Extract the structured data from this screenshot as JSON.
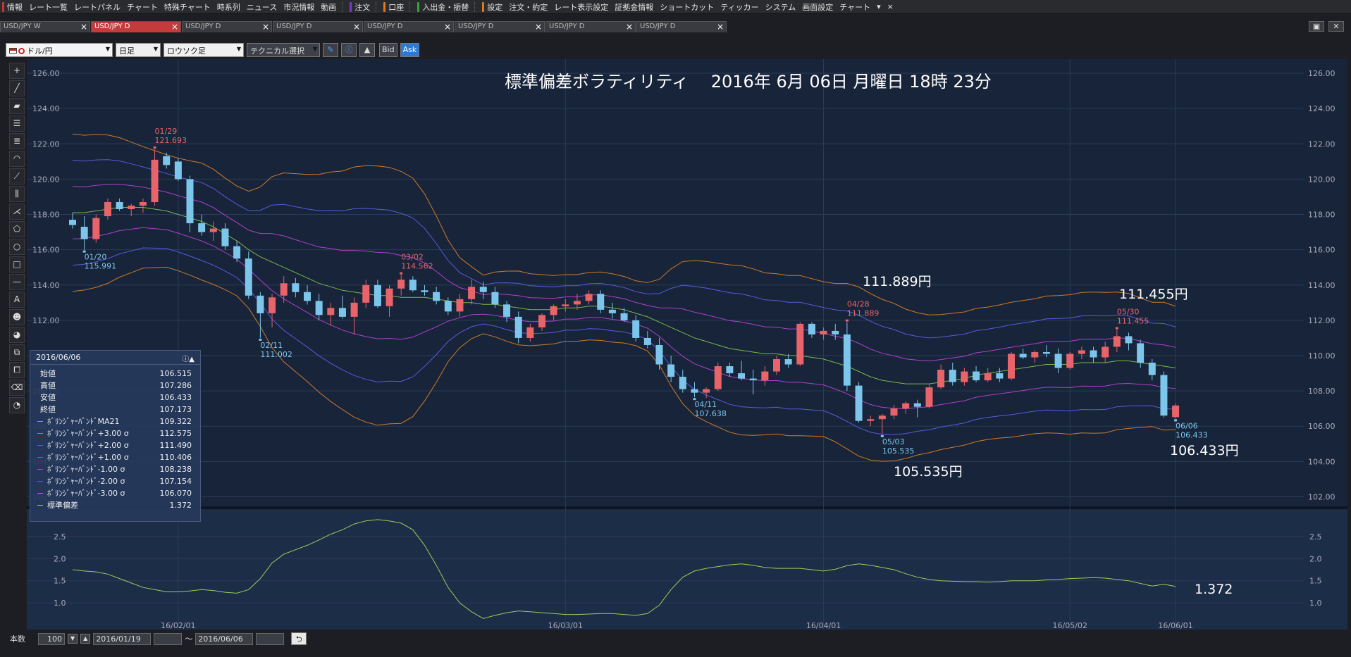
{
  "menu": {
    "items": [
      {
        "label": "情報",
        "color": "#d0342c"
      },
      {
        "label": "レート一覧",
        "color": ""
      },
      {
        "label": "レートパネル",
        "color": ""
      },
      {
        "label": "チャート",
        "color": ""
      },
      {
        "label": "特殊チャート",
        "color": ""
      },
      {
        "label": "時系列",
        "color": ""
      },
      {
        "label": "ニュース",
        "color": ""
      },
      {
        "label": "市況情報",
        "color": ""
      },
      {
        "label": "動画",
        "color": ""
      },
      {
        "label": "注文",
        "color": "#7a3cc8"
      },
      {
        "label": "口座",
        "color": "#e07820"
      },
      {
        "label": "入出金・振替",
        "color": "#3aa03a"
      },
      {
        "label": "設定",
        "color": "#e07820"
      },
      {
        "label": "注文・約定",
        "color": ""
      },
      {
        "label": "レート表示設定",
        "color": ""
      },
      {
        "label": "証拠金情報",
        "color": ""
      },
      {
        "label": "ショートカット",
        "color": ""
      },
      {
        "label": "ティッカー",
        "color": ""
      },
      {
        "label": "システム",
        "color": ""
      },
      {
        "label": "画面設定",
        "color": ""
      },
      {
        "label": "チャート",
        "color": ""
      }
    ],
    "more": "▾",
    "close": "×"
  },
  "tabs": [
    {
      "label": "USD/JPY W",
      "active": false
    },
    {
      "label": "USD/JPY D",
      "active": true
    },
    {
      "label": "USD/JPY D",
      "active": false
    },
    {
      "label": "USD/JPY D",
      "active": false
    },
    {
      "label": "USD/JPY D",
      "active": false
    },
    {
      "label": "USD/JPY D",
      "active": false
    },
    {
      "label": "USD/JPY D",
      "active": false
    },
    {
      "label": "USD/JPY D",
      "active": false
    }
  ],
  "toolbar": {
    "pair": "ドル/円",
    "period": "日足",
    "chart_type": "ロウソク足",
    "technical": "テクニカル選択",
    "bid": "Bid",
    "ask": "Ask"
  },
  "chart_title": "標準偏差ボラティリティ　 2016年 6月 06日 月曜日 18時 23分",
  "annotations": {
    "a1": "111.889円",
    "a2": "111.455円",
    "a3": "105.535円",
    "a4": "106.433円",
    "a5": "1.372"
  },
  "point_labels": [
    {
      "date": "01/29",
      "val": "121.693",
      "kind": "high"
    },
    {
      "date": "01/20",
      "val": "115.991",
      "kind": "low"
    },
    {
      "date": "03/02",
      "val": "114.562",
      "kind": "high"
    },
    {
      "date": "02/11",
      "val": "111.002",
      "kind": "low"
    },
    {
      "date": "04/28",
      "val": "111.889",
      "kind": "high"
    },
    {
      "date": "04/11",
      "val": "107.638",
      "kind": "low"
    },
    {
      "date": "05/03",
      "val": "105.535",
      "kind": "low"
    },
    {
      "date": "05/30",
      "val": "111.455",
      "kind": "high"
    },
    {
      "date": "06/06",
      "val": "106.433",
      "kind": "low"
    }
  ],
  "info": {
    "date": "2016/06/06",
    "rows": [
      {
        "label": "始値",
        "value": "106.515",
        "color": ""
      },
      {
        "label": "高値",
        "value": "107.286",
        "color": ""
      },
      {
        "label": "安値",
        "value": "106.433",
        "color": ""
      },
      {
        "label": "終値",
        "value": "107.173",
        "color": ""
      },
      {
        "label": "ﾎﾞﾘﾝｼﾞｬｰﾊﾞﾝﾄﾞMA21",
        "value": "109.322",
        "color": "#7ab84a"
      },
      {
        "label": "ﾎﾞﾘﾝｼﾞｬｰﾊﾞﾝﾄﾞ+3.00 σ",
        "value": "112.575",
        "color": "#d07a2a"
      },
      {
        "label": "ﾎﾞﾘﾝｼﾞｬｰﾊﾞﾝﾄﾞ+2.00 σ",
        "value": "111.490",
        "color": "#5a5ae0"
      },
      {
        "label": "ﾎﾞﾘﾝｼﾞｬｰﾊﾞﾝﾄﾞ+1.00 σ",
        "value": "110.406",
        "color": "#b040d0"
      },
      {
        "label": "ﾎﾞﾘﾝｼﾞｬｰﾊﾞﾝﾄﾞ-1.00 σ",
        "value": "108.238",
        "color": "#b040d0"
      },
      {
        "label": "ﾎﾞﾘﾝｼﾞｬｰﾊﾞﾝﾄﾞ-2.00 σ",
        "value": "107.154",
        "color": "#5a5ae0"
      },
      {
        "label": "ﾎﾞﾘﾝｼﾞｬｰﾊﾞﾝﾄﾞ-3.00 σ",
        "value": "106.070",
        "color": "#d07a2a"
      },
      {
        "label": "標準偏差",
        "value": "1.372",
        "color": "#9ccc5a"
      }
    ]
  },
  "bottom": {
    "count_label": "本数",
    "count": "100",
    "from": "2016/01/19",
    "tilde": "～",
    "to": "2016/06/06"
  },
  "chart_data": [
    {
      "type": "candlestick",
      "ylim": [
        101.5,
        126.8
      ],
      "y_ticks": [
        "126.00",
        "124.00",
        "122.00",
        "120.00",
        "118.00",
        "116.00",
        "114.00",
        "112.00",
        "110.00",
        "108.00",
        "106.00",
        "104.00",
        "102.00"
      ],
      "x_ticks": [
        "16/02/01",
        "16/03/01",
        "16/04/01",
        "16/05/02",
        "16/06/01"
      ],
      "ohlc": [
        [
          117.7,
          118.1,
          117.2,
          117.4
        ],
        [
          117.3,
          117.9,
          116.0,
          116.6
        ],
        [
          116.6,
          118.0,
          116.4,
          117.8
        ],
        [
          117.9,
          118.9,
          117.7,
          118.7
        ],
        [
          118.7,
          118.9,
          118.2,
          118.3
        ],
        [
          118.3,
          118.6,
          117.9,
          118.5
        ],
        [
          118.5,
          118.9,
          118.1,
          118.7
        ],
        [
          118.7,
          121.69,
          118.5,
          121.1
        ],
        [
          121.3,
          121.5,
          120.6,
          120.8
        ],
        [
          121.0,
          121.2,
          119.9,
          120.0
        ],
        [
          120.0,
          120.2,
          117.0,
          117.5
        ],
        [
          117.5,
          118.0,
          116.8,
          117.0
        ],
        [
          117.0,
          117.6,
          116.5,
          117.2
        ],
        [
          117.2,
          117.5,
          116.0,
          116.2
        ],
        [
          116.2,
          116.5,
          115.3,
          115.5
        ],
        [
          115.5,
          115.9,
          113.2,
          113.4
        ],
        [
          113.4,
          113.6,
          111.0,
          112.4
        ],
        [
          112.4,
          113.5,
          111.6,
          113.3
        ],
        [
          113.4,
          114.5,
          113.0,
          114.1
        ],
        [
          114.1,
          114.4,
          113.3,
          113.6
        ],
        [
          113.6,
          114.0,
          112.9,
          113.1
        ],
        [
          113.1,
          113.5,
          112.0,
          112.3
        ],
        [
          112.3,
          113.0,
          111.7,
          112.7
        ],
        [
          112.7,
          113.4,
          112.1,
          112.2
        ],
        [
          112.2,
          113.3,
          111.2,
          113.0
        ],
        [
          113.0,
          114.3,
          112.7,
          114.0
        ],
        [
          114.0,
          114.3,
          112.7,
          112.8
        ],
        [
          112.8,
          114.0,
          112.2,
          113.8
        ],
        [
          113.8,
          114.56,
          113.4,
          114.3
        ],
        [
          114.3,
          114.5,
          113.6,
          113.7
        ],
        [
          113.7,
          114.0,
          113.4,
          113.6
        ],
        [
          113.6,
          113.9,
          112.9,
          113.1
        ],
        [
          113.1,
          113.3,
          112.3,
          112.5
        ],
        [
          112.5,
          113.5,
          112.2,
          113.2
        ],
        [
          113.2,
          114.3,
          112.9,
          113.9
        ],
        [
          113.9,
          114.2,
          113.2,
          113.6
        ],
        [
          113.6,
          113.9,
          112.7,
          112.9
        ],
        [
          112.9,
          113.1,
          111.9,
          112.2
        ],
        [
          112.2,
          112.5,
          110.7,
          111.0
        ],
        [
          111.0,
          111.8,
          110.8,
          111.6
        ],
        [
          111.6,
          112.4,
          111.4,
          112.3
        ],
        [
          112.3,
          112.9,
          112.0,
          112.8
        ],
        [
          112.8,
          113.2,
          112.5,
          112.9
        ],
        [
          112.9,
          113.5,
          112.6,
          113.1
        ],
        [
          113.1,
          113.7,
          112.9,
          113.5
        ],
        [
          113.5,
          113.7,
          112.4,
          112.6
        ],
        [
          112.6,
          113.0,
          112.1,
          112.4
        ],
        [
          112.4,
          112.7,
          111.9,
          112.0
        ],
        [
          112.0,
          112.3,
          110.8,
          111.0
        ],
        [
          111.0,
          111.4,
          110.4,
          110.6
        ],
        [
          110.6,
          111.0,
          109.2,
          109.5
        ],
        [
          109.5,
          110.0,
          108.5,
          108.8
        ],
        [
          108.8,
          109.2,
          107.9,
          108.1
        ],
        [
          108.1,
          108.5,
          107.638,
          107.9
        ],
        [
          107.9,
          108.2,
          107.6,
          108.1
        ],
        [
          108.1,
          109.6,
          108.0,
          109.4
        ],
        [
          109.4,
          109.6,
          108.8,
          109.0
        ],
        [
          109.0,
          109.7,
          108.6,
          108.7
        ],
        [
          108.7,
          109.2,
          107.8,
          108.6
        ],
        [
          108.6,
          109.4,
          108.3,
          109.1
        ],
        [
          109.1,
          110.0,
          108.9,
          109.8
        ],
        [
          109.8,
          110.1,
          109.3,
          109.5
        ],
        [
          109.5,
          111.9,
          109.4,
          111.8
        ],
        [
          111.8,
          111.9,
          111.0,
          111.2
        ],
        [
          111.2,
          111.6,
          110.9,
          111.4
        ],
        [
          111.4,
          111.8,
          110.9,
          111.2
        ],
        [
          111.2,
          111.889,
          108.0,
          108.3
        ],
        [
          108.3,
          108.5,
          106.2,
          106.3
        ],
        [
          106.3,
          106.6,
          106.0,
          106.4
        ],
        [
          106.4,
          106.7,
          105.535,
          106.6
        ],
        [
          106.6,
          107.2,
          106.4,
          107.0
        ],
        [
          107.0,
          107.4,
          106.7,
          107.3
        ],
        [
          107.3,
          107.5,
          106.5,
          107.1
        ],
        [
          107.1,
          108.4,
          107.0,
          108.2
        ],
        [
          108.2,
          109.5,
          108.1,
          109.2
        ],
        [
          109.2,
          109.6,
          108.3,
          108.5
        ],
        [
          108.5,
          109.3,
          108.3,
          109.1
        ],
        [
          109.1,
          109.4,
          108.5,
          108.6
        ],
        [
          108.6,
          109.3,
          108.5,
          109.0
        ],
        [
          109.0,
          109.3,
          108.5,
          108.7
        ],
        [
          108.7,
          110.2,
          108.6,
          110.1
        ],
        [
          110.1,
          110.4,
          109.8,
          109.9
        ],
        [
          109.9,
          110.3,
          109.6,
          110.2
        ],
        [
          110.2,
          110.6,
          109.9,
          110.1
        ],
        [
          110.1,
          110.4,
          109.0,
          109.3
        ],
        [
          109.3,
          110.2,
          109.2,
          110.1
        ],
        [
          110.1,
          110.5,
          109.8,
          110.3
        ],
        [
          110.3,
          110.5,
          109.6,
          109.9
        ],
        [
          109.9,
          110.8,
          109.6,
          110.5
        ],
        [
          110.5,
          111.455,
          110.2,
          111.1
        ],
        [
          111.1,
          111.3,
          110.3,
          110.7
        ],
        [
          110.7,
          110.9,
          109.3,
          109.6
        ],
        [
          109.6,
          109.8,
          108.6,
          108.9
        ],
        [
          108.9,
          109.1,
          106.5,
          106.6
        ],
        [
          106.515,
          107.286,
          106.433,
          107.173
        ]
      ],
      "ma21": [
        118.1,
        118.1,
        118.2,
        118.3,
        118.4,
        118.4,
        118.4,
        118.3,
        118.2,
        118.0,
        117.8,
        117.6,
        117.3,
        116.9,
        116.5,
        116.0,
        115.6,
        115.3,
        115.0,
        114.7,
        114.4,
        114.1,
        113.9,
        113.7,
        113.6,
        113.5,
        113.4,
        113.4,
        113.3,
        113.3,
        113.3,
        113.2,
        113.1,
        113.0,
        113.0,
        112.9,
        112.9,
        112.8,
        112.7,
        112.6,
        112.6,
        112.6,
        112.7,
        112.7,
        112.8,
        112.8,
        112.7,
        112.6,
        112.4,
        112.2,
        111.9,
        111.6,
        111.3,
        111.0,
        110.8,
        110.6,
        110.4,
        110.3,
        110.2,
        110.1,
        110.1,
        110.0,
        110.0,
        109.9,
        109.8,
        109.6,
        109.4,
        109.1,
        108.8,
        108.6,
        108.5,
        108.4,
        108.4,
        108.4,
        108.5,
        108.6,
        108.7,
        108.9,
        109.0,
        109.1,
        109.2,
        109.3,
        109.4,
        109.5,
        109.5,
        109.5,
        109.6,
        109.6,
        109.6,
        109.7,
        109.7,
        109.6,
        109.5,
        109.4,
        109.3
      ],
      "sd": [
        1.75,
        1.72,
        1.7,
        1.65,
        1.55,
        1.45,
        1.35,
        1.3,
        1.25,
        1.25,
        1.27,
        1.3,
        1.28,
        1.24,
        1.22,
        1.3,
        1.55,
        1.9,
        2.1,
        2.2,
        2.3,
        2.42,
        2.55,
        2.65,
        2.78,
        2.85,
        2.88,
        2.85,
        2.8,
        2.65,
        2.3,
        1.85,
        1.35,
        1.0,
        0.8,
        0.65,
        0.72,
        0.78,
        0.82,
        0.8,
        0.78,
        0.76,
        0.74,
        0.74,
        0.75,
        0.76,
        0.76,
        0.74,
        0.72,
        0.76,
        0.95,
        1.3,
        1.58,
        1.72,
        1.78,
        1.82,
        1.86,
        1.88,
        1.85,
        1.8,
        1.78,
        1.78,
        1.78,
        1.75,
        1.72,
        1.76,
        1.84,
        1.88,
        1.85,
        1.8,
        1.75,
        1.66,
        1.58,
        1.53,
        1.5,
        1.49,
        1.48,
        1.48,
        1.47,
        1.48,
        1.5,
        1.5,
        1.5,
        1.52,
        1.53,
        1.55,
        1.56,
        1.57,
        1.56,
        1.53,
        1.5,
        1.44,
        1.38,
        1.42,
        1.372
      ]
    },
    {
      "type": "line",
      "name": "標準偏差",
      "ylim": [
        0.4,
        3.1
      ],
      "y_ticks": [
        "2.5",
        "2.0",
        "1.5",
        "1.0"
      ]
    }
  ]
}
